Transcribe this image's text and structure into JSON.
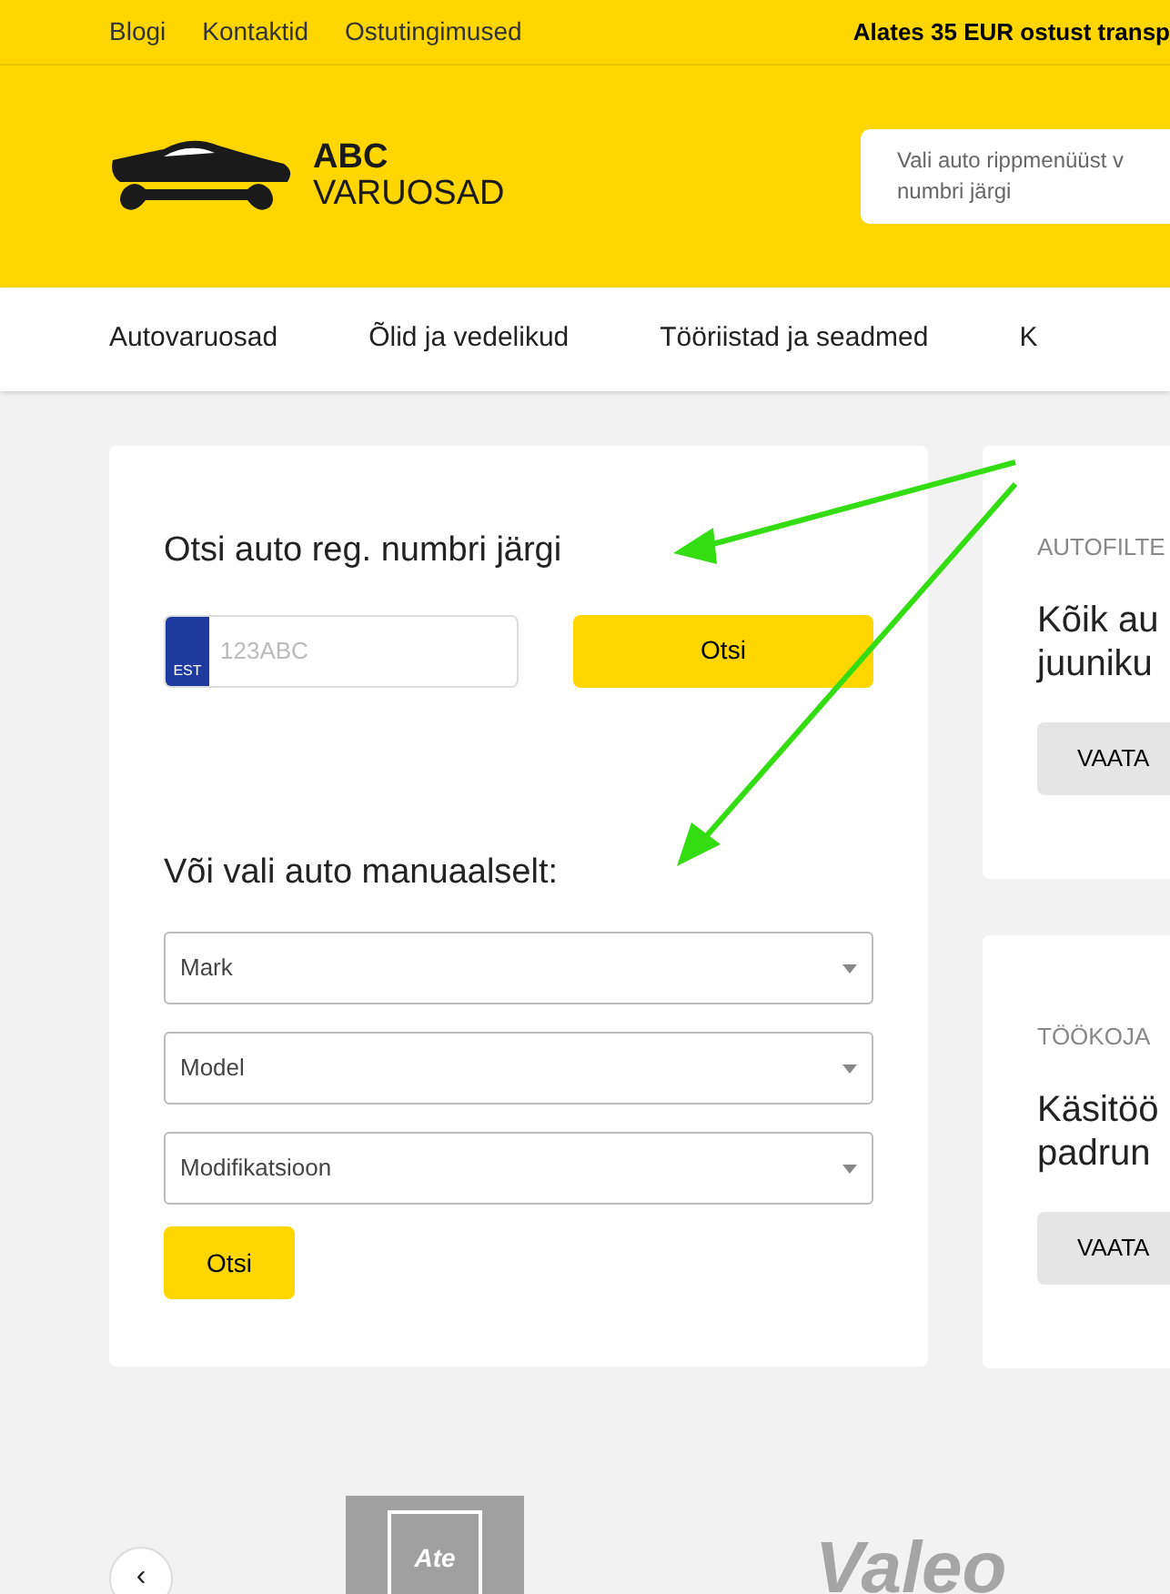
{
  "top_bar": {
    "links": [
      "Blogi",
      "Kontaktid",
      "Ostutingimused"
    ],
    "notice": "Alates 35 EUR ostust transp"
  },
  "header": {
    "logo_line1": "ABC",
    "logo_line2": "VARUOSAD",
    "search_placeholder": "Vali auto rippmenüüst v\nnumbri järgi"
  },
  "nav": [
    "Autovaruosad",
    "Õlid ja vedelikud",
    "Tööriistad ja seadmed",
    "K"
  ],
  "plate_search": {
    "title": "Otsi auto reg. numbri järgi",
    "country": "EST",
    "placeholder": "123ABC",
    "button": "Otsi"
  },
  "manual_search": {
    "title": "Või vali auto manuaalselt:",
    "selects": [
      "Mark",
      "Model",
      "Modifikatsioon"
    ],
    "button": "Otsi"
  },
  "side_cards": [
    {
      "eyebrow": "AUTOFILTE",
      "title": "Kõik au\njuuniku",
      "button": "VAATA"
    },
    {
      "eyebrow": "TÖÖKOJA",
      "title": "Käsitöö\npadrun",
      "button": "VAATA"
    }
  ],
  "brands": {
    "prev": "‹",
    "logos": [
      {
        "kind": "boxed",
        "text": "Ate"
      },
      {
        "kind": "plain",
        "text": "Valeo"
      }
    ]
  }
}
